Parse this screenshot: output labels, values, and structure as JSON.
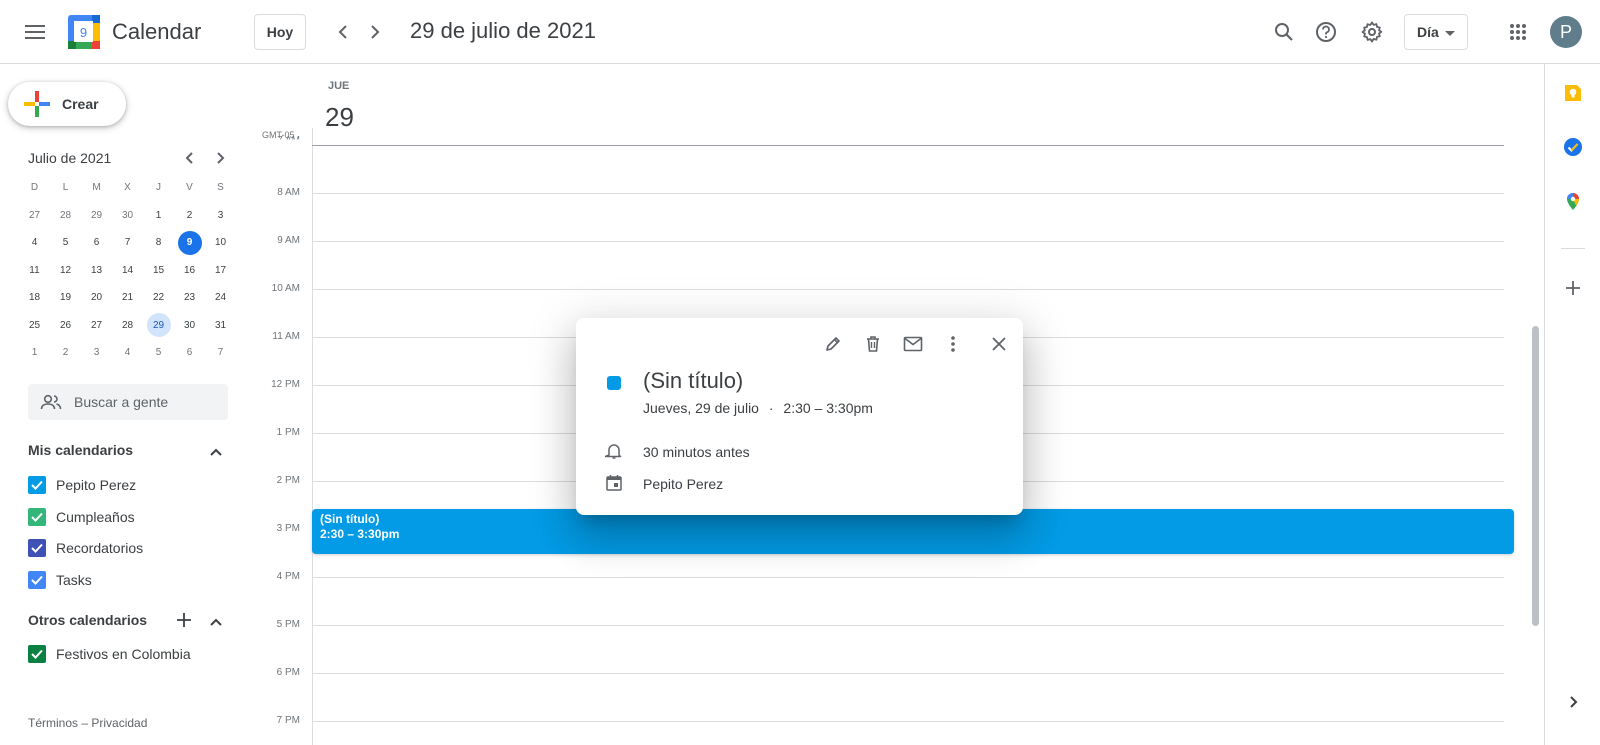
{
  "header": {
    "app_title": "Calendar",
    "today_label": "Hoy",
    "date_title": "29 de julio de 2021",
    "view_label": "Día",
    "avatar_initial": "P",
    "logo_number": "9"
  },
  "sidebar": {
    "create_label": "Crear",
    "mini_calendar": {
      "title": "Julio de 2021",
      "weekdays": [
        "D",
        "L",
        "M",
        "X",
        "J",
        "V",
        "S"
      ],
      "weeks": [
        [
          "27",
          "28",
          "29",
          "30",
          "1",
          "2",
          "3"
        ],
        [
          "4",
          "5",
          "6",
          "7",
          "8",
          "9",
          "10"
        ],
        [
          "11",
          "12",
          "13",
          "14",
          "15",
          "16",
          "17"
        ],
        [
          "18",
          "19",
          "20",
          "21",
          "22",
          "23",
          "24"
        ],
        [
          "25",
          "26",
          "27",
          "28",
          "29",
          "30",
          "31"
        ],
        [
          "1",
          "2",
          "3",
          "4",
          "5",
          "6",
          "7"
        ]
      ],
      "today": "9",
      "selected": "29"
    },
    "people_search_placeholder": "Buscar a gente",
    "my_calendars_title": "Mis calendarios",
    "my_calendars": [
      {
        "label": "Pepito Perez",
        "color": "#039be5"
      },
      {
        "label": "Cumpleaños",
        "color": "#33b679"
      },
      {
        "label": "Recordatorios",
        "color": "#3f51b5"
      },
      {
        "label": "Tasks",
        "color": "#4285f4"
      }
    ],
    "other_calendars_title": "Otros calendarios",
    "other_calendars": [
      {
        "label": "Festivos en Colombia",
        "color": "#0b8043"
      }
    ],
    "footer": "Términos – Privacidad"
  },
  "day_view": {
    "day_label": "JUE",
    "day_number": "29",
    "timezone": "GMT-05",
    "hours": [
      "7 AM",
      "8 AM",
      "9 AM",
      "10 AM",
      "11 AM",
      "12 PM",
      "1 PM",
      "2 PM",
      "3 PM",
      "4 PM",
      "5 PM",
      "6 PM",
      "7 PM"
    ]
  },
  "event": {
    "title": "(Sin título)",
    "time": "2:30 – 3:30pm",
    "color": "#039be5"
  },
  "popup": {
    "title": "(Sin título)",
    "date": "Jueves, 29 de julio",
    "separator": "·",
    "time": "2:30 – 3:30pm",
    "reminder": "30 minutos antes",
    "calendar": "Pepito Perez"
  },
  "right_panel": {
    "icons": [
      "keep-icon",
      "tasks-icon",
      "maps-icon",
      "add-icon",
      "expand-icon"
    ]
  }
}
